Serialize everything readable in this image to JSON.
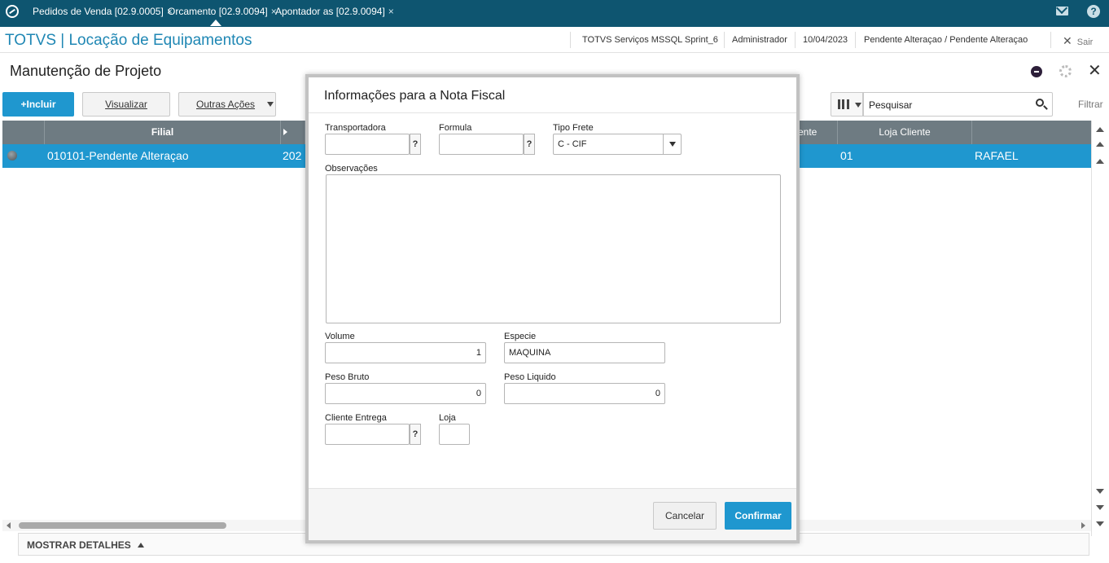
{
  "tabs": [
    {
      "label": "Pedidos de Venda [02.9.0005]"
    },
    {
      "label": "Orcamento [02.9.0094]"
    },
    {
      "label": "Apontador as [02.9.0094]"
    }
  ],
  "tab_close_glyph": "×",
  "header": {
    "app_title": "TOTVS | Locação de Equipamentos",
    "environment": "TOTVS Serviços MSSQL Sprint_6",
    "user": "Administrador",
    "date": "10/04/2023",
    "status": "Pendente Alteraçao / Pendente Alteraçao",
    "exit_label": "Sair"
  },
  "page": {
    "title": "Manutenção de Projeto"
  },
  "toolbar": {
    "include_label": "+Incluir",
    "view_label": "Visualizar",
    "other_actions_label": "Outras Ações",
    "search_placeholder": "Pesquisar",
    "filter_label": "Filtrar"
  },
  "grid": {
    "columns": [
      "Filial",
      "ente",
      "Loja Cliente"
    ],
    "row": {
      "filial": "010101-Pendente Alteraçao",
      "partial": "202",
      "loja": "01",
      "cliente": "RAFAEL"
    }
  },
  "details": {
    "label": "MOSTRAR DETALHES"
  },
  "modal": {
    "title": "Informações para a Nota Fiscal",
    "transportadora_label": "Transportadora",
    "formula_label": "Formula",
    "tipo_frete_label": "Tipo Frete",
    "tipo_frete_value": "C - CIF",
    "observacoes_label": "Observações",
    "volume_label": "Volume",
    "volume_value": "1",
    "especie_label": "Especie",
    "especie_value": "MAQUINA",
    "peso_bruto_label": "Peso Bruto",
    "peso_bruto_value": "0",
    "peso_liquido_label": "Peso Liquido",
    "peso_liquido_value": "0",
    "cliente_entrega_label": "Cliente Entrega",
    "loja_label": "Loja",
    "lookup_glyph": "?",
    "cancel_label": "Cancelar",
    "confirm_label": "Confirmar"
  },
  "colors": {
    "topbar": "#0e5570",
    "accent": "#1f97cf",
    "title": "#1f87b4",
    "grid_header": "#6e7b82"
  },
  "icons": [
    "app-logo-icon",
    "mail-icon",
    "help-icon",
    "close-icon",
    "gear-icon",
    "search-icon",
    "columns-icon",
    "chevron-down-icon"
  ]
}
